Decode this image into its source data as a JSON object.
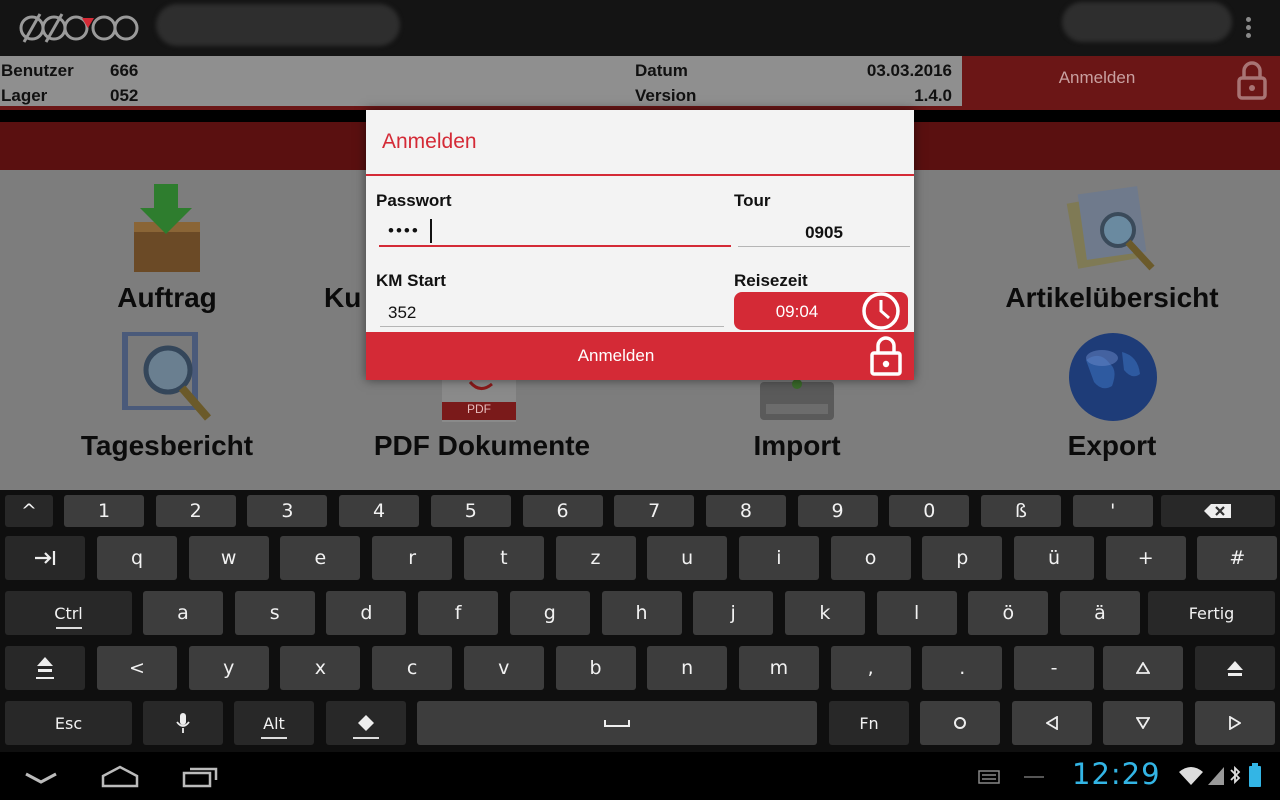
{
  "colors": {
    "accent": "#d42a36",
    "dark_red": "#6b1616",
    "status_blue": "#33b5e5"
  },
  "header": {
    "benutzer_label": "Benutzer",
    "benutzer_value": "666",
    "lager_label": "Lager",
    "lager_value": "052",
    "datum_label": "Datum",
    "datum_value": "03.03.2016",
    "version_label": "Version",
    "version_value": "1.4.0",
    "login_label": "Anmelden",
    "login_icon": "lock-icon"
  },
  "tiles": {
    "auftrag": "Auftrag",
    "kunden_partial": "Ku",
    "artikel": "Artikelübersicht",
    "tagesbericht": "Tagesbericht",
    "pdf": "PDF Dokumente",
    "pdf_badge": "PDF",
    "import": "Import",
    "export": "Export"
  },
  "dialog": {
    "title": "Anmelden",
    "passwort_label": "Passwort",
    "passwort_value": "••••",
    "tour_label": "Tour",
    "tour_value": "0905",
    "km_label": "KM Start",
    "km_value": "352",
    "reisezeit_label": "Reisezeit",
    "reisezeit_value": "09:04",
    "reisezeit_icon": "clock-icon",
    "submit_label": "Anmelden",
    "submit_icon": "lock-icon"
  },
  "keyboard": {
    "row1": [
      "^",
      "1",
      "2",
      "3",
      "4",
      "5",
      "6",
      "7",
      "8",
      "9",
      "0",
      "ß",
      "'"
    ],
    "row1_backspace": "backspace-icon",
    "row2_tab": "tab-icon",
    "row2": [
      "q",
      "w",
      "e",
      "r",
      "t",
      "z",
      "u",
      "i",
      "o",
      "p",
      "ü",
      "+",
      "#"
    ],
    "row3_ctrl": "Ctrl",
    "row3": [
      "a",
      "s",
      "d",
      "f",
      "g",
      "h",
      "j",
      "k",
      "l",
      "ö",
      "ä"
    ],
    "row3_done": "Fertig",
    "row4": [
      "<",
      "y",
      "x",
      "c",
      "v",
      "b",
      "n",
      "m",
      ",",
      ".",
      "-"
    ],
    "row5_esc": "Esc",
    "row5_alt": "Alt",
    "row5_fn": "Fn",
    "row5_space": "⎵"
  },
  "status": {
    "time": "12:29"
  }
}
